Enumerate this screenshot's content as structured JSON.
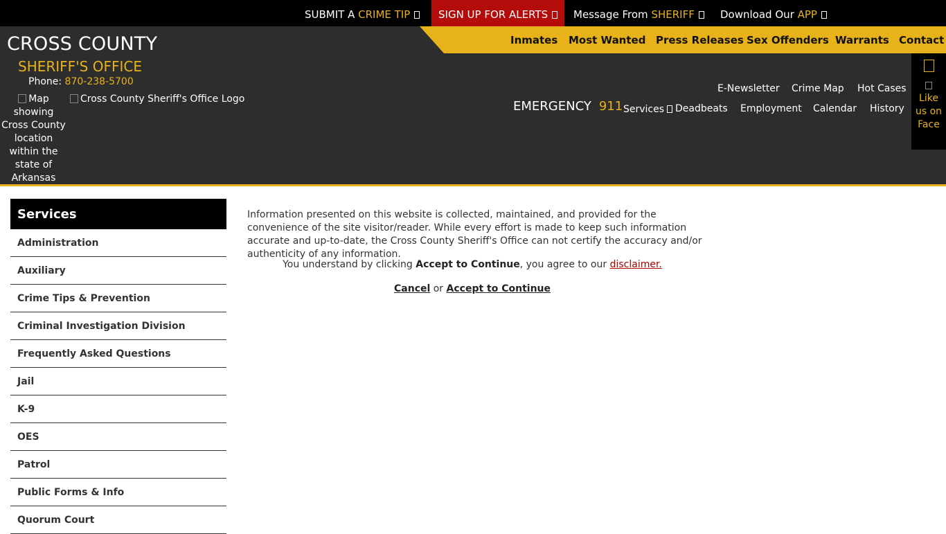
{
  "topbar": {
    "crime_tip_prefix": "SUBMIT A",
    "crime_tip_highlight": "CRIME TIP",
    "alerts_label": "SIGN UP FOR ALERTS",
    "message_prefix": "Message From",
    "message_highlight": "SHERIFF",
    "app_prefix": "Download Our",
    "app_highlight": "APP"
  },
  "brand": {
    "title": "CROSS COUNTY",
    "subtitle": "SHERIFF'S OFFICE",
    "phone_label": "Phone:",
    "phone_number": "870-238-5700",
    "map_alt": "Map showing Cross County location within the state of Arkansas Arkansas",
    "logo_alt": "Cross County Sheriff's Office Logo"
  },
  "main_nav": [
    "Inmates",
    "Most Wanted",
    "Press Releases",
    "Sex Offenders",
    "Warrants",
    "Contact"
  ],
  "emergency": {
    "label": "EMERGENCY",
    "number": "911"
  },
  "secondary_nav": {
    "row1": [
      "E-Newsletter",
      "Crime Map",
      "Hot Cases"
    ],
    "row2": [
      "Services",
      "Deadbeats",
      "Employment",
      "Calendar",
      "History"
    ]
  },
  "facebook": {
    "label": "Like us on Face"
  },
  "sidebar": {
    "heading": "Services",
    "items": [
      "Administration",
      "Auxiliary",
      "Crime Tips & Prevention",
      "Criminal Investigation Division",
      "Frequently Asked Questions",
      "Jail",
      "K-9",
      "OES",
      "Patrol",
      "Public Forms & Info",
      "Quorum Court"
    ]
  },
  "content": {
    "disclaimer_text": "Information presented on this website is collected, maintained, and provided for the convenience of the site visitor/reader. While every effort is made to keep such information accurate and up-to-date, the Cross County Sheriff's Office can not certify the accuracy and/or authenticity of any information.",
    "agree_prefix": "You understand by clicking",
    "agree_bold": "Accept to Continue",
    "agree_middle": ", you agree to our",
    "disclaimer_link": "disclaimer.",
    "cancel_label": "Cancel",
    "or_label": "or",
    "accept_label": "Accept to Continue"
  },
  "colors": {
    "gold": "#e7b21a",
    "header_bg": "#2d2d2d",
    "alert_red": "#b40b0b"
  }
}
